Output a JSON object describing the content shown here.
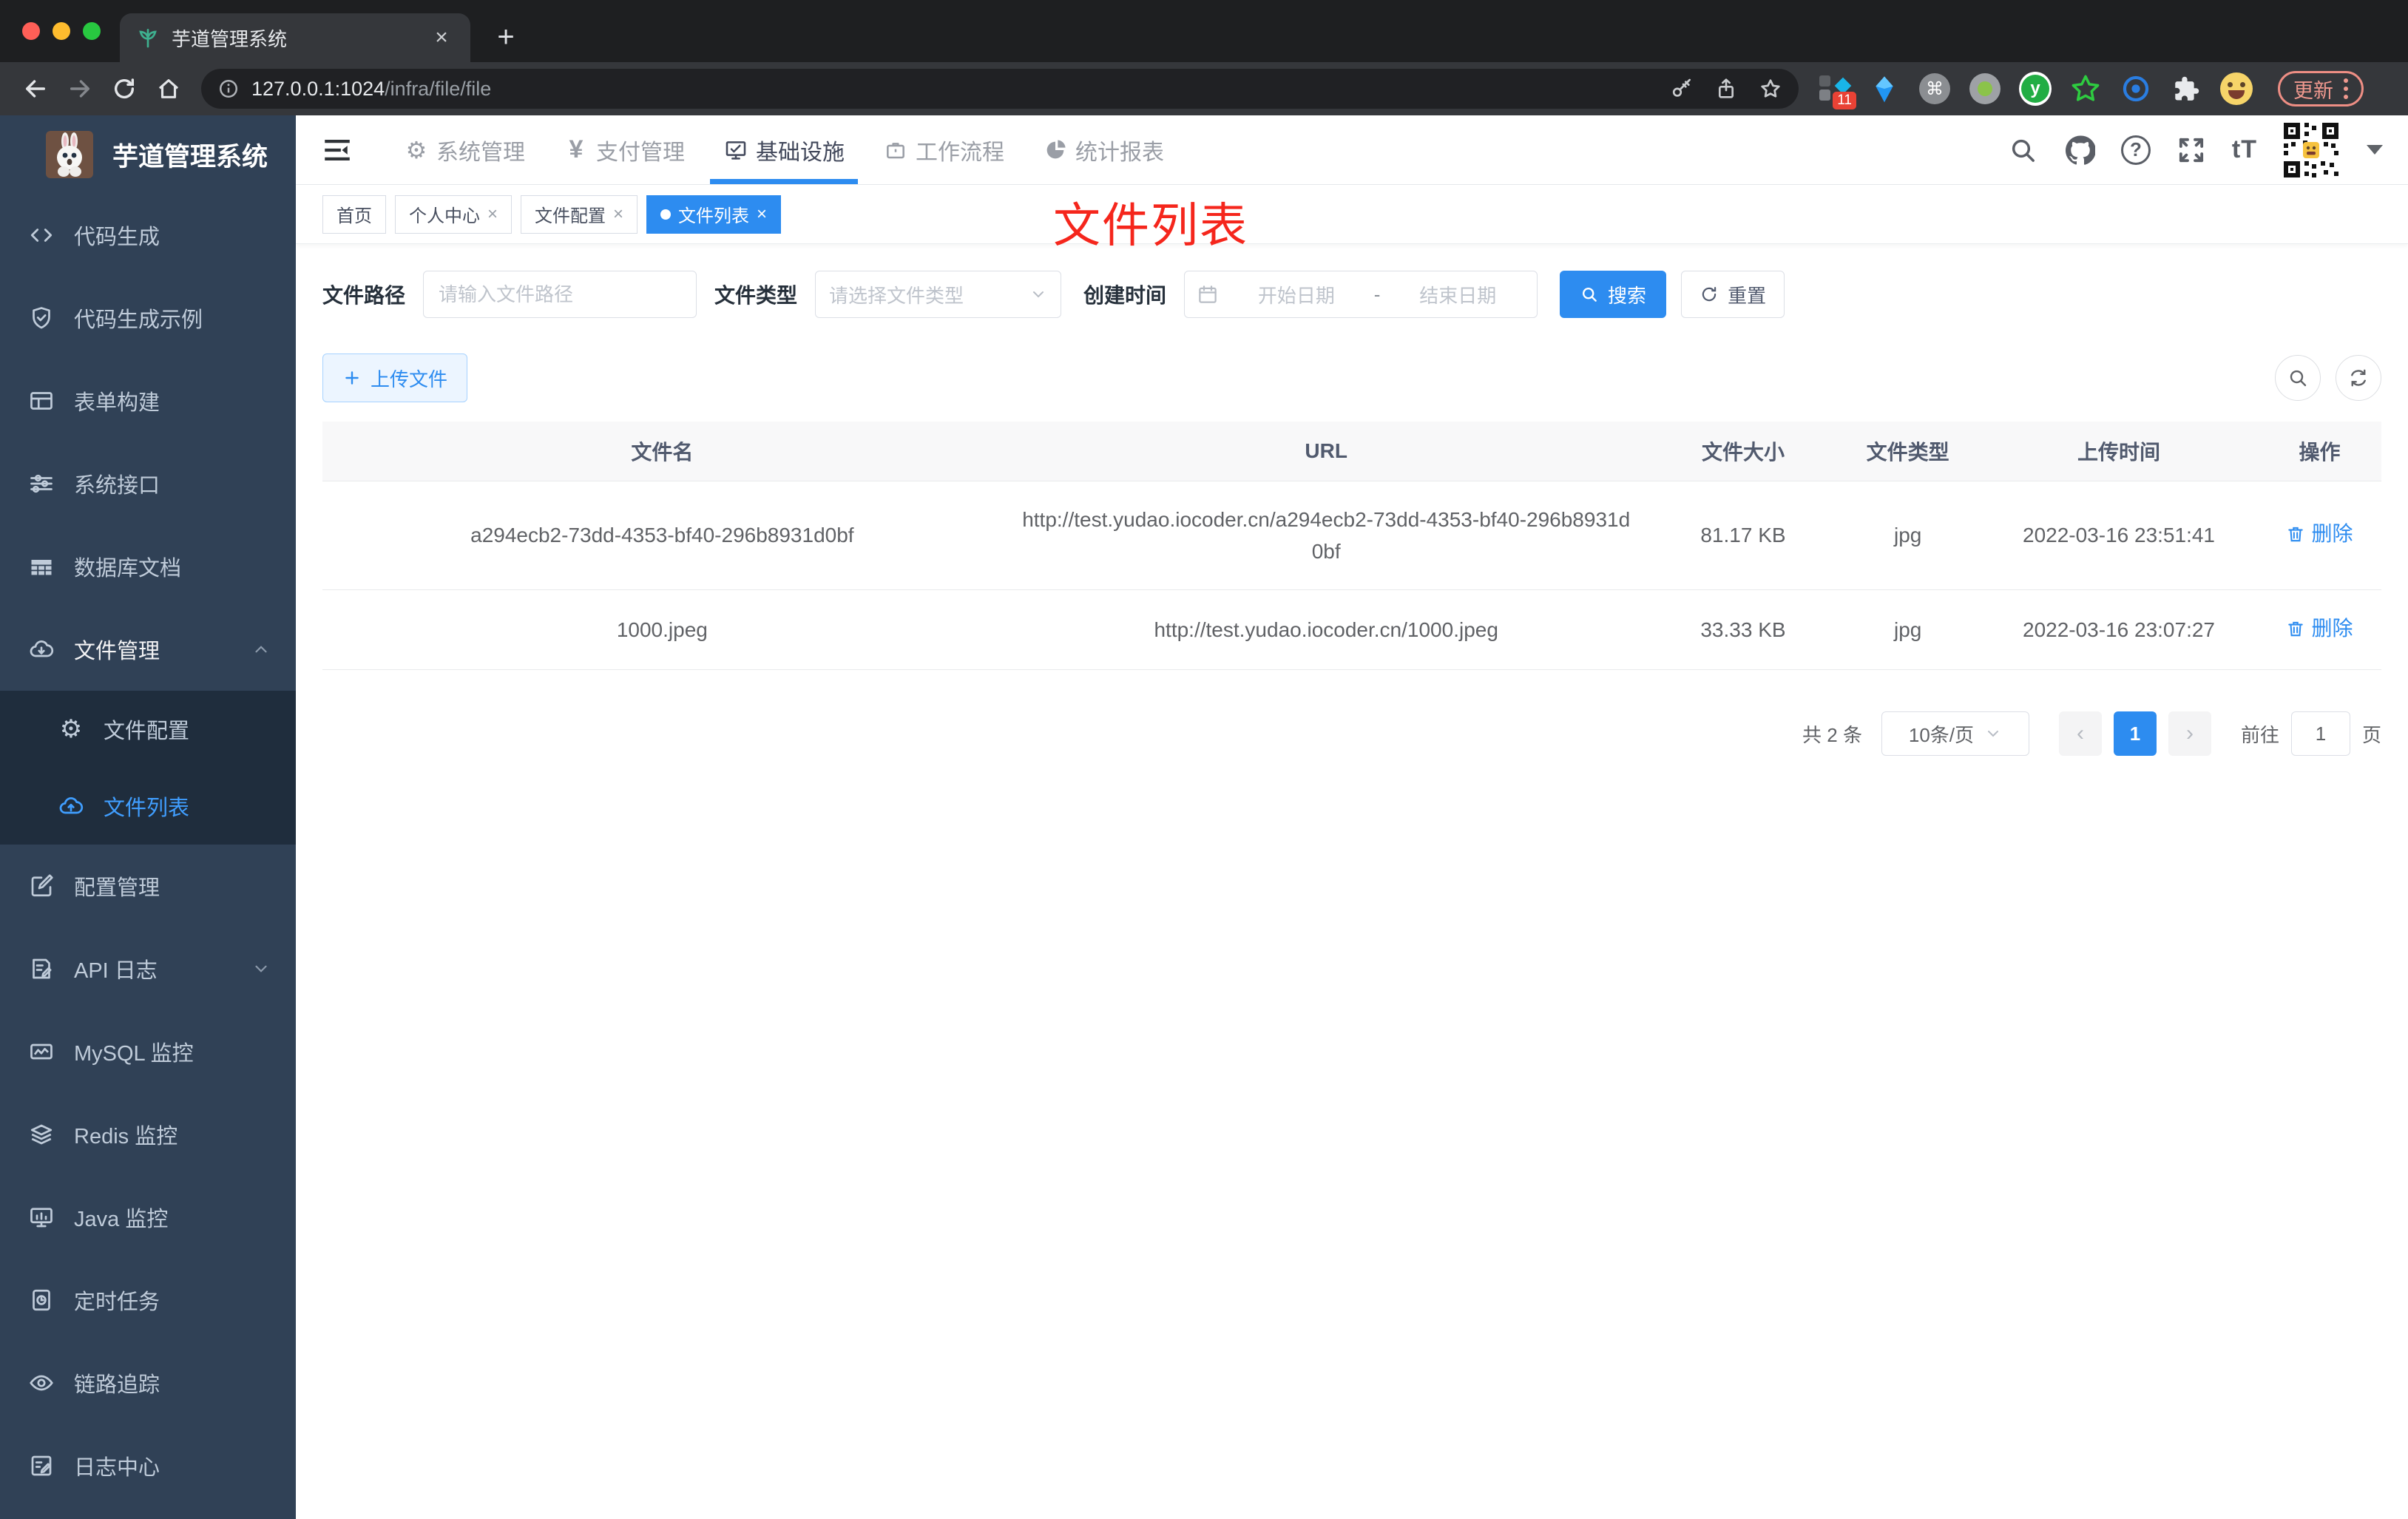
{
  "colors": {
    "accent": "#2d8cf0",
    "menu_active": "#409eff",
    "annotation_red": "#f5261c",
    "sidebar_bg": "#304156",
    "submenu_bg": "#1f2d3d"
  },
  "browser": {
    "tab_title": "芋道管理系统",
    "url_host": "127.0.0.1:1024",
    "url_path": "/infra/file/file",
    "ext_badge": "11",
    "update_label": "更新"
  },
  "sidebar": {
    "title": "芋道管理系统",
    "items_top": [
      {
        "icon": "code-icon",
        "label": "代码生成"
      },
      {
        "icon": "shield-check-icon",
        "label": "代码生成示例"
      },
      {
        "icon": "form-icon",
        "label": "表单构建"
      },
      {
        "icon": "sliders-icon",
        "label": "系统接口"
      },
      {
        "icon": "database-doc-icon",
        "label": "数据库文档"
      },
      {
        "icon": "cloud-download-icon",
        "label": "文件管理",
        "expanded": true
      }
    ],
    "submenu": [
      {
        "icon": "gear-icon",
        "label": "文件配置"
      },
      {
        "icon": "cloud-upload-icon",
        "label": "文件列表",
        "active": true
      }
    ],
    "items_bottom": [
      {
        "icon": "edit-icon",
        "label": "配置管理"
      },
      {
        "icon": "api-log-icon",
        "label": "API 日志",
        "collapsed": true
      },
      {
        "icon": "mysql-chart-icon",
        "label": "MySQL 监控"
      },
      {
        "icon": "redis-layers-icon",
        "label": "Redis 监控"
      },
      {
        "icon": "java-monitor-icon",
        "label": "Java 监控"
      },
      {
        "icon": "schedule-icon",
        "label": "定时任务"
      },
      {
        "icon": "trace-eye-icon",
        "label": "链路追踪"
      },
      {
        "icon": "log-center-icon",
        "label": "日志中心"
      }
    ]
  },
  "navbar": {
    "tabs": [
      {
        "icon": "gear-icon",
        "label": "系统管理"
      },
      {
        "icon": "yen-icon",
        "label": "支付管理"
      },
      {
        "icon": "monitor-check-icon",
        "label": "基础设施",
        "active": true
      },
      {
        "icon": "briefcase-icon",
        "label": "工作流程"
      },
      {
        "icon": "pie-icon",
        "label": "统计报表"
      }
    ]
  },
  "tags": {
    "items": [
      {
        "label": "首页"
      },
      {
        "label": "个人中心",
        "closable": true
      },
      {
        "label": "文件配置",
        "closable": true
      },
      {
        "label": "文件列表",
        "closable": true,
        "active": true
      }
    ]
  },
  "annotation": {
    "text": "文件列表"
  },
  "filters": {
    "path_label": "文件路径",
    "path_placeholder": "请输入文件路径",
    "type_label": "文件类型",
    "type_placeholder": "请选择文件类型",
    "date_label": "创建时间",
    "date_start_placeholder": "开始日期",
    "date_separator": "-",
    "date_end_placeholder": "结束日期",
    "search_label": "搜索",
    "reset_label": "重置"
  },
  "actions": {
    "upload_label": "上传文件"
  },
  "table": {
    "columns": [
      "文件名",
      "URL",
      "文件大小",
      "文件类型",
      "上传时间",
      "操作"
    ],
    "rows": [
      {
        "name": "a294ecb2-73dd-4353-bf40-296b8931d0bf",
        "url": "http://test.yudao.iocoder.cn/a294ecb2-73dd-4353-bf40-296b8931d0bf",
        "size": "81.17 KB",
        "type": "jpg",
        "time": "2022-03-16 23:51:41",
        "action": "删除"
      },
      {
        "name": "1000.jpeg",
        "url": "http://test.yudao.iocoder.cn/1000.jpeg",
        "size": "33.33 KB",
        "type": "jpg",
        "time": "2022-03-16 23:07:27",
        "action": "删除"
      }
    ]
  },
  "pagination": {
    "total": "共 2 条",
    "page_size": "10条/页",
    "current": "1",
    "goto_label": "前往",
    "goto_value": "1",
    "page_unit": "页"
  }
}
